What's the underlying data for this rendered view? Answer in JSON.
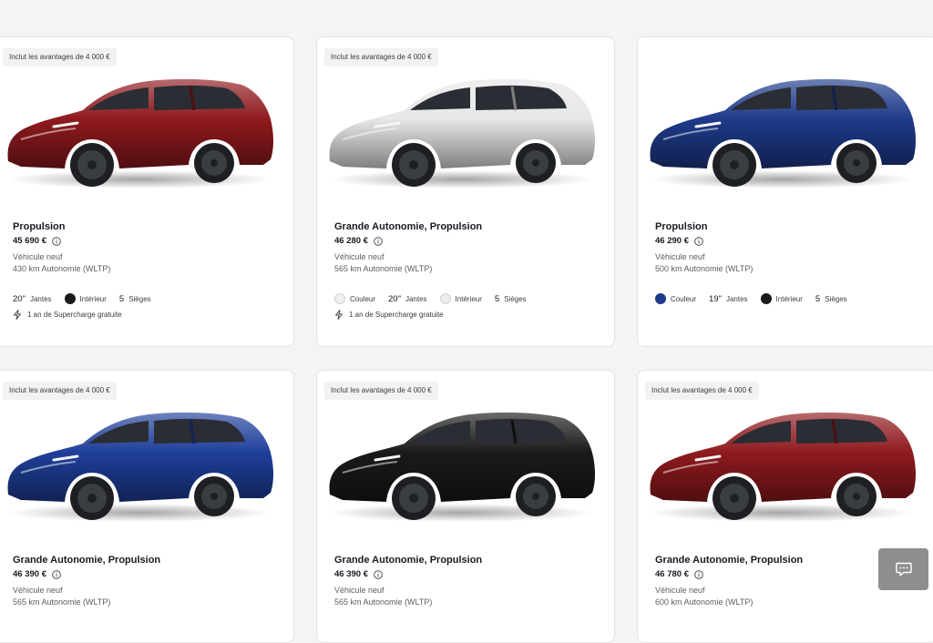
{
  "cards": [
    {
      "badge": "Inclut les avantages de 4 000 €",
      "model": "Propulsion",
      "price": "45 690 €",
      "condition": "Véhicule neuf",
      "range": "430 km Autonomie (WLTP)",
      "paint_color": "#8f1a1e",
      "specs": [
        {
          "value": "20\"",
          "label": "Jantes"
        },
        {
          "swatch": "#1b1b1b",
          "label": "Intérieur"
        },
        {
          "value": "5",
          "label": "Sièges"
        }
      ],
      "perk": "1 an de Supercharge gratuite"
    },
    {
      "badge": "Inclut les avantages de 4 000 €",
      "model": "Grande Autonomie, Propulsion",
      "price": "46 280 €",
      "condition": "Véhicule neuf",
      "range": "565 km Autonomie (WLTP)",
      "paint_color": "#e6e7e8",
      "specs": [
        {
          "swatch": "#f1f1f1",
          "label": "Couleur"
        },
        {
          "value": "20\"",
          "label": "Jantes"
        },
        {
          "swatch": "#ececec",
          "label": "Intérieur"
        },
        {
          "value": "5",
          "label": "Sièges"
        }
      ],
      "perk": "1 an de Supercharge gratuite"
    },
    {
      "model": "Propulsion",
      "price": "46 290 €",
      "condition": "Véhicule neuf",
      "range": "500 km Autonomie (WLTP)",
      "paint_color": "#1e3a8a",
      "specs": [
        {
          "swatch": "#1e3a8a",
          "label": "Couleur"
        },
        {
          "value": "19\"",
          "label": "Jantes"
        },
        {
          "swatch": "#1b1b1b",
          "label": "Intérieur"
        },
        {
          "value": "5",
          "label": "Sièges"
        }
      ]
    },
    {
      "badge": "Inclut les avantages de 4 000 €",
      "model": "Grande Autonomie, Propulsion",
      "price": "46 390 €",
      "condition": "Véhicule neuf",
      "range": "565 km Autonomie (WLTP)",
      "paint_color": "#1f3f9a"
    },
    {
      "badge": "Inclut les avantages de 4 000 €",
      "model": "Grande Autonomie, Propulsion",
      "price": "46 390 €",
      "condition": "Véhicule neuf",
      "range": "565 km Autonomie (WLTP)",
      "paint_color": "#1a1a1a"
    },
    {
      "badge": "Inclut les avantages de 4 000 €",
      "model": "Grande Autonomie, Propulsion",
      "price": "46 780 €",
      "condition": "Véhicule neuf",
      "range": "600 km Autonomie (WLTP)",
      "paint_color": "#8f1a1e"
    }
  ],
  "chat_button": {
    "icon": "chat-icon"
  }
}
